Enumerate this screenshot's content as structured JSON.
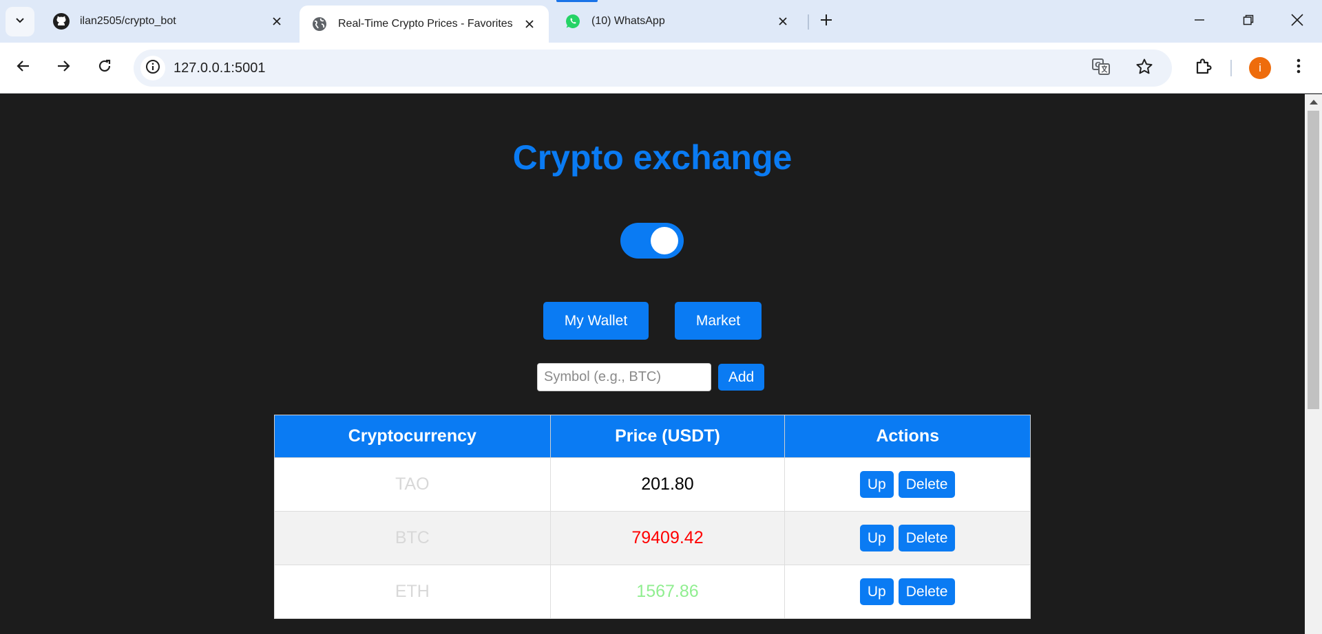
{
  "browser": {
    "tabs": [
      {
        "title": "ilan2505/crypto_bot",
        "icon": "github-icon",
        "active": false
      },
      {
        "title": "Real-Time Crypto Prices - Favorites",
        "icon": "globe-icon",
        "active": true
      },
      {
        "title": "(10) WhatsApp",
        "icon": "whatsapp-icon",
        "active": false
      }
    ],
    "url": "127.0.0.1:5001",
    "profile_initial": "i",
    "colors": {
      "accent": "#1a73e8",
      "avatar": "#ee6c0c"
    }
  },
  "page": {
    "title": "Crypto exchange",
    "theme_toggle_on": true,
    "nav": {
      "wallet_label": "My Wallet",
      "market_label": "Market"
    },
    "add_form": {
      "placeholder": "Symbol (e.g., BTC)",
      "value": "",
      "button_label": "Add"
    },
    "table": {
      "headers": [
        "Cryptocurrency",
        "Price (USDT)",
        "Actions"
      ],
      "rows": [
        {
          "symbol": "TAO",
          "price": "201.80",
          "trend": "neutral",
          "up_label": "Up",
          "delete_label": "Delete"
        },
        {
          "symbol": "BTC",
          "price": "79409.42",
          "trend": "down",
          "up_label": "Up",
          "delete_label": "Delete"
        },
        {
          "symbol": "ETH",
          "price": "1567.86",
          "trend": "up",
          "up_label": "Up",
          "delete_label": "Delete"
        }
      ]
    },
    "colors": {
      "primary": "#0a7bf3",
      "background": "#1c1c1c",
      "price_down": "#ff0000",
      "price_up": "#90ee90"
    }
  }
}
